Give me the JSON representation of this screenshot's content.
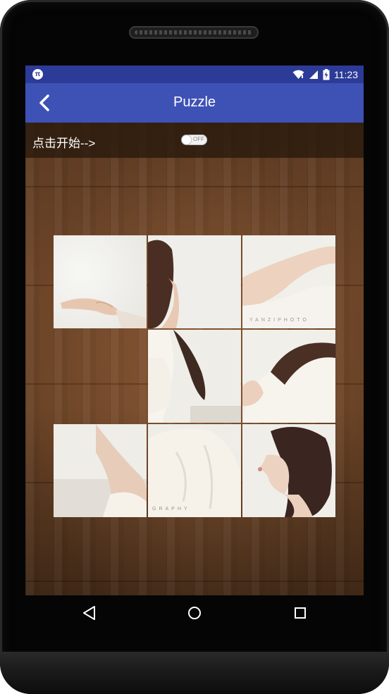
{
  "statusbar": {
    "app_icon_label": "π",
    "time": "11:23",
    "icons": [
      "wifi-icon",
      "cell-signal-icon",
      "battery-icon"
    ]
  },
  "appbar": {
    "title": "Puzzle",
    "back_icon": "chevron-left-icon",
    "color": "#3e51b5"
  },
  "controls": {
    "start_label": "点击开始-->",
    "toggle_state_text": "OFF",
    "toggle_on": false
  },
  "puzzle": {
    "grid_size": 3,
    "tiles": [
      {
        "id": "tile-1",
        "empty": false,
        "caption": ""
      },
      {
        "id": "tile-2",
        "empty": false,
        "caption": ""
      },
      {
        "id": "tile-3",
        "empty": false,
        "caption": "YANZIPHOTO"
      },
      {
        "id": "empty",
        "empty": true,
        "caption": ""
      },
      {
        "id": "tile-5",
        "empty": false,
        "caption": ""
      },
      {
        "id": "tile-6",
        "empty": false,
        "caption": ""
      },
      {
        "id": "tile-7",
        "empty": false,
        "caption": ""
      },
      {
        "id": "tile-8",
        "empty": false,
        "caption": "GRAPHY"
      },
      {
        "id": "tile-9",
        "empty": false,
        "caption": ""
      }
    ]
  },
  "navbar": {
    "buttons": [
      "back-triangle-icon",
      "home-circle-icon",
      "recents-square-icon"
    ]
  },
  "colors": {
    "status_bar": "#2c3b97",
    "app_bar": "#3e51b5",
    "wood": "#6e4528"
  }
}
